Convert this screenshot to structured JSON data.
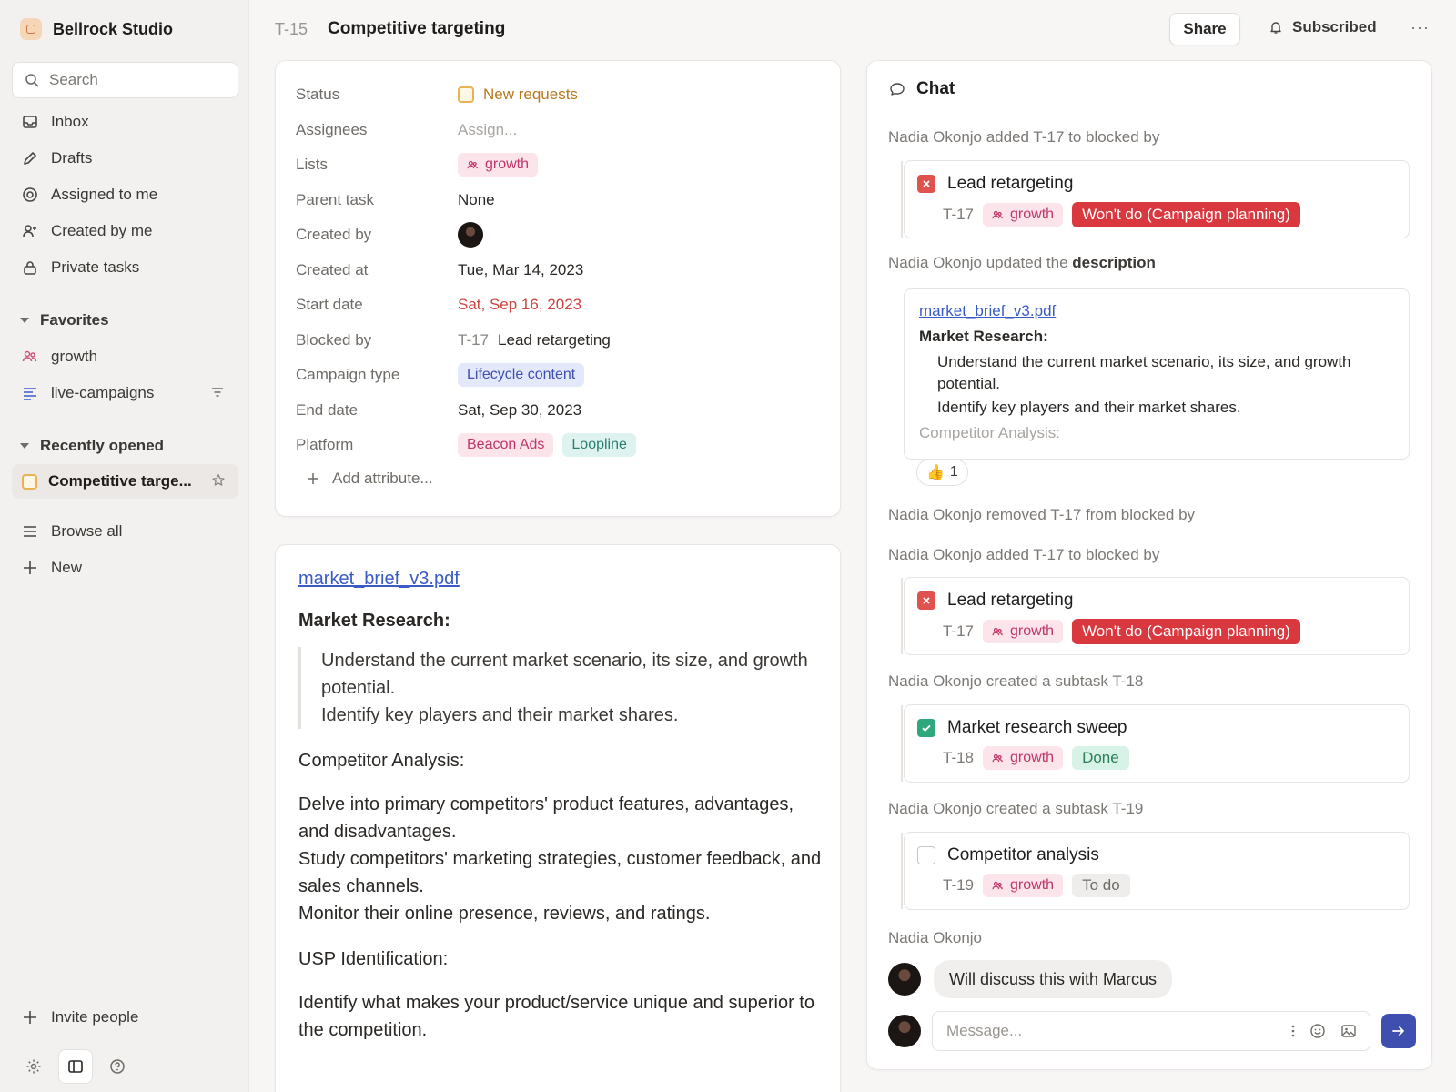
{
  "workspace": {
    "name": "Bellrock Studio"
  },
  "search": {
    "placeholder": "Search"
  },
  "nav": {
    "inbox": "Inbox",
    "drafts": "Drafts",
    "assigned": "Assigned to me",
    "created": "Created by me",
    "private": "Private tasks"
  },
  "favorites": {
    "heading": "Favorites",
    "items": [
      "growth",
      "live-campaigns"
    ]
  },
  "recent": {
    "heading": "Recently opened",
    "items": [
      "Competitive targe..."
    ]
  },
  "browse": {
    "browse_all": "Browse all",
    "new": "New"
  },
  "invite": "Invite people",
  "header": {
    "task_id": "T-15",
    "title": "Competitive targeting",
    "share": "Share",
    "subscribed": "Subscribed",
    "more": "···"
  },
  "properties": {
    "status_label": "Status",
    "status_value": "New requests",
    "assignees_label": "Assignees",
    "assignees_value": "Assign...",
    "lists_label": "Lists",
    "lists_value": "growth",
    "parent_label": "Parent task",
    "parent_value": "None",
    "created_by_label": "Created by",
    "created_at_label": "Created at",
    "created_at_value": "Tue, Mar 14, 2023",
    "start_label": "Start date",
    "start_value": "Sat, Sep 16, 2023",
    "blocked_label": "Blocked by",
    "blocked_id": "T-17",
    "blocked_title": "Lead retargeting",
    "campaign_label": "Campaign type",
    "campaign_value": "Lifecycle content",
    "end_label": "End date",
    "end_value": "Sat, Sep 30, 2023",
    "platform_label": "Platform",
    "platform_values": [
      "Beacon Ads",
      "Loopline"
    ],
    "add_attribute": "Add attribute..."
  },
  "description": {
    "file": "market_brief_v3.pdf",
    "h_market": "Market Research:",
    "market_lines": [
      "Understand the current market scenario, its size, and growth potential.",
      "Identify key players and their market shares."
    ],
    "h_competitor": "Competitor Analysis:",
    "competitor_lines": [
      "Delve into primary competitors' product features, advantages, and disadvantages.",
      "Study competitors' marketing strategies, customer feedback, and sales channels.",
      "Monitor their online presence, reviews, and ratings."
    ],
    "h_usp": "USP Identification:",
    "usp_lines": [
      "Identify what makes your product/service unique and superior to the competition."
    ]
  },
  "chat": {
    "title": "Chat",
    "events": [
      "Nadia Okonjo added T-17 to blocked by",
      "Nadia Okonjo updated the",
      "Nadia Okonjo removed T-17 from blocked by",
      "Nadia Okonjo added T-17 to blocked by",
      "Nadia Okonjo created a subtask T-18",
      "Nadia Okonjo created a subtask T-19"
    ],
    "event_bold": "description",
    "refs": [
      {
        "title": "Lead retargeting",
        "id": "T-17",
        "list": "growth",
        "status": "Won't do (Campaign planning)"
      },
      {
        "title": "Lead retargeting",
        "id": "T-17",
        "list": "growth",
        "status": "Won't do (Campaign planning)"
      },
      {
        "title": "Market research sweep",
        "id": "T-18",
        "list": "growth",
        "status": "Done"
      },
      {
        "title": "Competitor analysis",
        "id": "T-19",
        "list": "growth",
        "status": "To do"
      }
    ],
    "desc_ref": {
      "file": "market_brief_v3.pdf",
      "heading": "Market Research:",
      "line1": "Understand the current market scenario, its size, and growth potential.",
      "line2": "Identify key players and their market shares.",
      "faded": "Competitor Analysis:"
    },
    "reaction": {
      "emoji": "👍",
      "count": "1"
    },
    "message_author": "Nadia Okonjo",
    "message_text": "Will discuss this with Marcus",
    "composer_placeholder": "Message..."
  },
  "colors": {
    "accent": "#3f4fb0",
    "danger": "#d9383f",
    "success": "#2fa77d",
    "tag_pink": "#c1366a"
  }
}
